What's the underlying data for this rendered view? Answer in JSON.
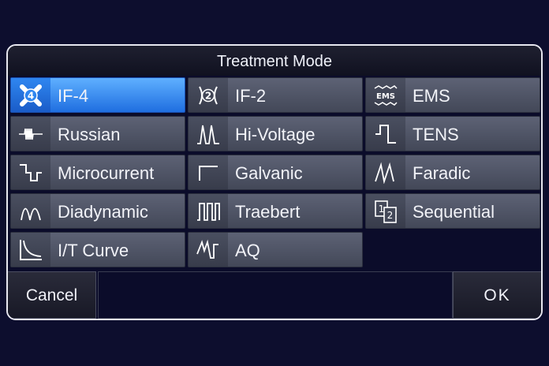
{
  "dialog": {
    "title": "Treatment Mode",
    "modes": [
      {
        "label": "IF-4",
        "icon": "if4-icon",
        "selected": true
      },
      {
        "label": "IF-2",
        "icon": "if2-icon",
        "selected": false
      },
      {
        "label": "EMS",
        "icon": "ems-icon",
        "selected": false
      },
      {
        "label": "Russian",
        "icon": "russian-icon",
        "selected": false
      },
      {
        "label": "Hi-Voltage",
        "icon": "hi-voltage-icon",
        "selected": false
      },
      {
        "label": "TENS",
        "icon": "tens-icon",
        "selected": false
      },
      {
        "label": "Microcurrent",
        "icon": "microcurrent-icon",
        "selected": false
      },
      {
        "label": "Galvanic",
        "icon": "galvanic-icon",
        "selected": false
      },
      {
        "label": "Faradic",
        "icon": "faradic-icon",
        "selected": false
      },
      {
        "label": "Diadynamic",
        "icon": "diadynamic-icon",
        "selected": false
      },
      {
        "label": "Traebert",
        "icon": "traebert-icon",
        "selected": false
      },
      {
        "label": "Sequential",
        "icon": "sequential-icon",
        "selected": false
      },
      {
        "label": "I/T Curve",
        "icon": "it-curve-icon",
        "selected": false
      },
      {
        "label": "AQ",
        "icon": "aq-icon",
        "selected": false
      }
    ],
    "icon_text": {
      "if4": "4",
      "if2": "2",
      "ems": "EMS",
      "seq_a": "1",
      "seq_b": "2"
    },
    "footer": {
      "cancel_label": "Cancel",
      "ok_label": "OK"
    }
  },
  "colors": {
    "background": "#0d0e2e",
    "button": "#4f5466",
    "selected": "#2f86f0",
    "border": "#e8e8f0"
  }
}
